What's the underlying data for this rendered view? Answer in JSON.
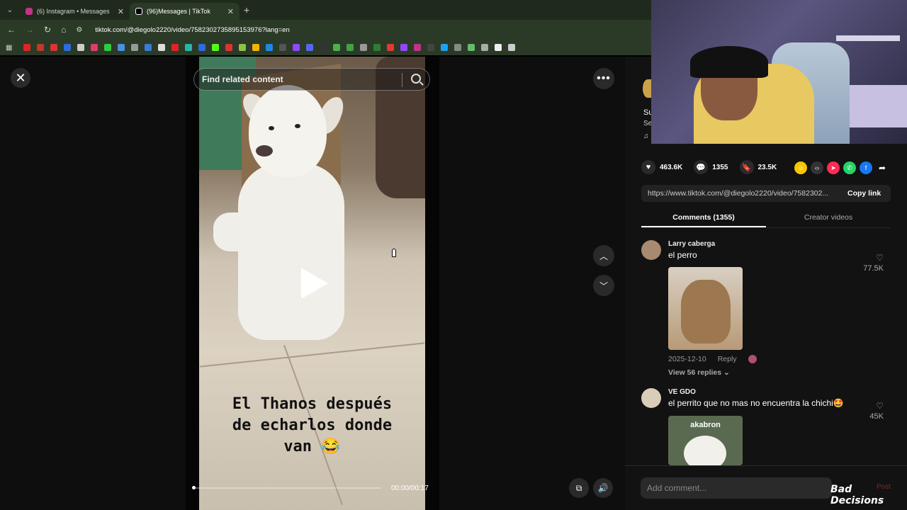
{
  "browser": {
    "tabs": [
      {
        "title": "(6) Instagram • Messages",
        "color": "#c13584"
      },
      {
        "title": "(96)Messages | TikTok",
        "color": "#000000"
      }
    ],
    "url": "tiktok.com/@diegolo2220/video/7582302735895153976?lang=en"
  },
  "video": {
    "search_placeholder": "Find related content",
    "caption_line1": "El Thanos después",
    "caption_line2": "de echarlos donde",
    "caption_line3": "van 😂",
    "timecode": "00:00/00:17",
    "progress": 0
  },
  "actions": {
    "likes": "463.6K",
    "comments": "1355",
    "saves": "23.5K"
  },
  "share": {
    "link": "https://www.tiktok.com/@diegolo2220/video/7582302...",
    "copy_label": "Copy link"
  },
  "tabs": {
    "comments": "Comments (1355)",
    "creator": "Creator videos"
  },
  "peek": {
    "line1": "Su",
    "line2": "Se",
    "line3": "♫"
  },
  "comments": [
    {
      "user": "Larry caberga",
      "text": "el perro",
      "likes": "77.5K",
      "date": "2025-12-10",
      "reply_label": "Reply",
      "view_replies": "View 56 replies ⌄"
    },
    {
      "user": "VE GDO",
      "text": "el perrito que no mas no encuentra la chichi🤩",
      "likes": "45K",
      "img_text": "akabron"
    }
  ],
  "add_comment_placeholder": "Add comment...",
  "watermark": "Bad Decisions",
  "post_label": "Post"
}
